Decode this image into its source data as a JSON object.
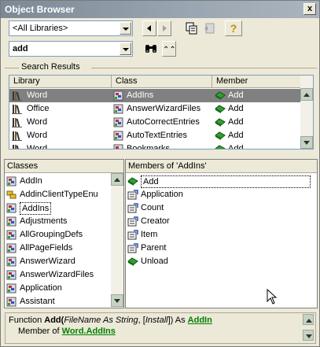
{
  "window": {
    "title": "Object Browser",
    "close_glyph": "x"
  },
  "toolbar": {
    "library_combo": "<All Libraries>",
    "search_combo": "add",
    "back_icon": "back-arrow-icon",
    "forward_icon": "forward-arrow-icon",
    "copy_icon": "copy-to-clipboard-icon",
    "view_def_icon": "view-definition-icon",
    "help_glyph": "?",
    "search_glyph": "binoculars-icon",
    "toggle_glyph": "⌃⌃"
  },
  "search_results": {
    "label": "Search Results",
    "headers": [
      "Library",
      "Class",
      "Member"
    ],
    "rows": [
      {
        "library": "Word",
        "class": "AddIns",
        "member": "Add",
        "selected": true
      },
      {
        "library": "Office",
        "class": "AnswerWizardFiles",
        "member": "Add",
        "selected": false
      },
      {
        "library": "Word",
        "class": "AutoCorrectEntries",
        "member": "Add",
        "selected": false
      },
      {
        "library": "Word",
        "class": "AutoTextEntries",
        "member": "Add",
        "selected": false
      },
      {
        "library": "Word",
        "class": "Bookmarks",
        "member": "Add",
        "selected": false
      }
    ]
  },
  "classes": {
    "header": "Classes",
    "items": [
      {
        "label": "AddIn",
        "icon": "class-icon"
      },
      {
        "label": "AddinClientTypeEnu",
        "icon": "enum-icon"
      },
      {
        "label": "AddIns",
        "icon": "class-icon",
        "focused": true
      },
      {
        "label": "Adjustments",
        "icon": "class-icon"
      },
      {
        "label": "AllGroupingDefs",
        "icon": "class-icon"
      },
      {
        "label": "AllPageFields",
        "icon": "class-icon"
      },
      {
        "label": "AnswerWizard",
        "icon": "class-icon"
      },
      {
        "label": "AnswerWizardFiles",
        "icon": "class-icon"
      },
      {
        "label": "Application",
        "icon": "class-icon"
      },
      {
        "label": "Assistant",
        "icon": "class-icon"
      }
    ]
  },
  "members": {
    "header": "Members of 'AddIns'",
    "items": [
      {
        "label": "Add",
        "icon": "method-icon",
        "focused": true
      },
      {
        "label": "Application",
        "icon": "property-icon"
      },
      {
        "label": "Count",
        "icon": "property-icon"
      },
      {
        "label": "Creator",
        "icon": "property-icon"
      },
      {
        "label": "Item",
        "icon": "property-icon"
      },
      {
        "label": "Parent",
        "icon": "property-icon"
      },
      {
        "label": "Unload",
        "icon": "method-icon"
      }
    ]
  },
  "details": {
    "kw_function": "Function",
    "name": "Add",
    "open_paren": "(",
    "param1": "FileName As String",
    "sep": ", [",
    "param2": "Install",
    "close": "]) As",
    "return_type": "AddIn",
    "member_of": "Member of",
    "lib": "Word",
    "dot": ".",
    "cls": "AddIns"
  },
  "colors": {
    "selection": "#808080",
    "link": "#008000",
    "title_bar": "#8b97a3"
  }
}
